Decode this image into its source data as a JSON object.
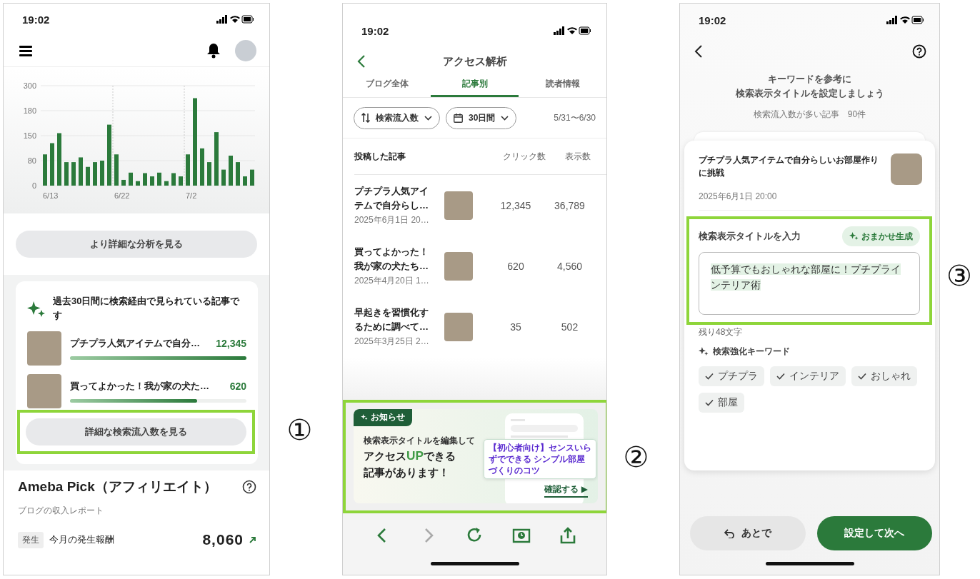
{
  "markers": [
    "①",
    "②",
    "③"
  ],
  "screen1": {
    "status_time": "19:02",
    "chart": {
      "y_labels": [
        "300",
        "180",
        "150",
        "80",
        "0"
      ],
      "x_labels": [
        "6/13",
        "6/22",
        "7/2"
      ]
    },
    "analysis_button": "より詳細な分析を見る",
    "search_card": {
      "title": "過去30日間に検索経由で見られている記事です",
      "articles": [
        {
          "title": "プチプラ人気アイテムで自分…",
          "count": "12,345",
          "level": 1
        },
        {
          "title": "買ってよかった！我が家の犬た…",
          "count": "620",
          "level": 0.72
        }
      ],
      "button": "詳細な検索流入数を見る"
    },
    "affiliate": {
      "title": "Ameba Pick（アフィリエイト）",
      "subtitle": "ブログの収入レポート",
      "badge": "発生",
      "label": "今月の発生報酬",
      "amount": "8,060"
    }
  },
  "screen2": {
    "status_time": "19:02",
    "title": "アクセス解析",
    "tabs": [
      {
        "label": "ブログ全体",
        "selected": false
      },
      {
        "label": "記事別",
        "selected": true
      },
      {
        "label": "読者情報",
        "selected": false
      }
    ],
    "filters": [
      {
        "kind": "sort",
        "label": "検索流入数"
      },
      {
        "kind": "calendar",
        "label": "30日間"
      }
    ],
    "date_range": "5/31〜6/30",
    "table": {
      "columns": [
        "投稿した記事",
        "クリック数",
        "表示数"
      ],
      "rows": [
        {
          "title": "プチプラ人気アイテムで自分らし…",
          "date": "2025年6月1日 20…",
          "clicks": "12,345",
          "views": "36,789"
        },
        {
          "title": "買ってよかった！我が家の犬たち…",
          "date": "2025年4月20日 1…",
          "clicks": "620",
          "views": "4,560"
        },
        {
          "title": "早起きを習慣化するために調べて…",
          "date": "2025年3月25日 2…",
          "clicks": "35",
          "views": "502"
        }
      ]
    },
    "banner": {
      "tag": "お知らせ",
      "line1": "検索表示タイトルを編集して",
      "line2": "アクセス**UP**できる",
      "line3": "記事があります！",
      "mock_result": "【初心者向け】センスいらずでできる シンプル部屋づくりのコツ",
      "cta": "確認する ▶"
    },
    "toolbar": [
      {
        "kind": "back",
        "disabled": false
      },
      {
        "kind": "forward",
        "disabled": true
      },
      {
        "kind": "reload",
        "disabled": false
      },
      {
        "kind": "history",
        "disabled": false
      },
      {
        "kind": "share",
        "disabled": false
      }
    ]
  },
  "screen3": {
    "status_time": "19:02",
    "heading": [
      "キーワードを参考に",
      "検索表示タイトルを設定しましょう"
    ],
    "subtitle": "検索流入数が多い記事　90件",
    "article": {
      "title": "プチプラ人気アイテムで自分らしいお部屋作りに挑戦",
      "date": "2025年6月1日 20:00"
    },
    "input_label": "検索表示タイトルを入力",
    "generate_button": "おまかせ生成",
    "title_value": "低予算でもおしゃれな部屋に！プチプラインテリア術",
    "remaining": "残り48文字",
    "keywords_label": "検索強化キーワード",
    "keywords": [
      {
        "label": "プチプラ",
        "checked": true
      },
      {
        "label": "インテリア",
        "checked": true
      },
      {
        "label": "おしゃれ",
        "checked": true
      },
      {
        "label": "部屋",
        "checked": true
      }
    ],
    "later_button": "あとで",
    "next_button": "設定して次へ"
  }
}
